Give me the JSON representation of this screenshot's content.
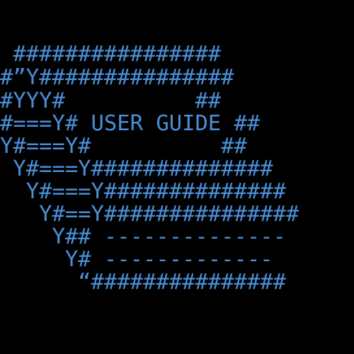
{
  "colors": {
    "background": "#000000",
    "text": "#4a8fd6"
  },
  "art": {
    "lines": [
      " ################",
      "#”Y###############",
      "#YYY#          ##",
      "#===Y# USER GUIDE ##",
      "Y#===Y#          ##",
      " Y#===Y##############",
      "  Y#===Y##############",
      "   Y#==Y###############",
      "    Y## --------------",
      "     Y# -------------",
      "      “###############"
    ]
  }
}
